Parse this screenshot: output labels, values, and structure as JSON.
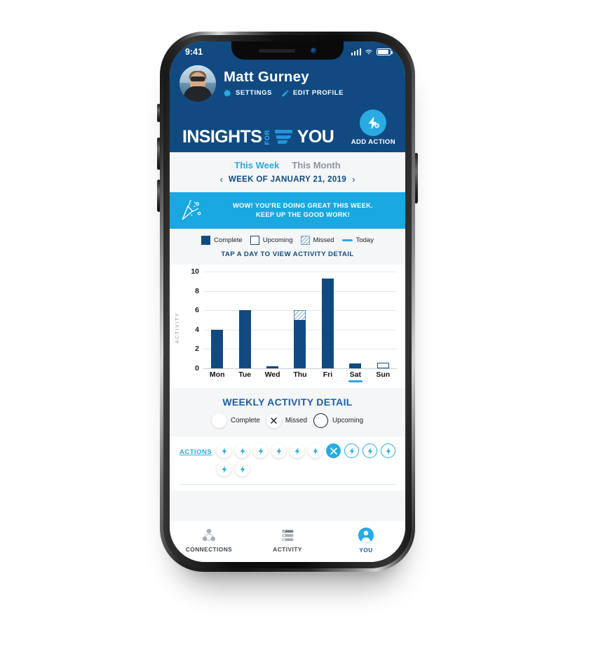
{
  "status_bar": {
    "time": "9:41",
    "signal_icon": "cellular-bars-icon",
    "wifi_icon": "wifi-icon",
    "battery_icon": "battery-icon"
  },
  "header": {
    "user_name": "Matt Gurney",
    "avatar_alt": "avatar",
    "settings_label": "SETTINGS",
    "settings_icon": "gear-icon",
    "edit_profile_label": "EDIT PROFILE",
    "edit_profile_icon": "pencil-icon",
    "logo_word1": "INSIGHTS",
    "logo_for": "FOR",
    "logo_word2": "YOU",
    "add_action_label": "ADD ACTION",
    "add_action_icon": "bolt-plus-icon",
    "bg_color": "#104a81",
    "accent_color": "#29aae2"
  },
  "tabs": [
    {
      "label": "This Week",
      "active": true
    },
    {
      "label": "This Month",
      "active": false
    }
  ],
  "week_nav": {
    "prev_icon": "chevron-left-icon",
    "next_icon": "chevron-right-icon",
    "label": "WEEK OF JANUARY 21, 2019"
  },
  "banner": {
    "icon": "party-popper-icon",
    "line1": "WOW! YOU'RE DOING GREAT THIS WEEK.",
    "line2": "KEEP UP THE GOOD WORK!",
    "bg_color": "#19a8e0"
  },
  "legend": [
    {
      "label": "Complete",
      "type": "complete"
    },
    {
      "label": "Upcoming",
      "type": "upcoming"
    },
    {
      "label": "Missed",
      "type": "missed"
    },
    {
      "label": "Today",
      "type": "today"
    }
  ],
  "tap_hint": "TAP A DAY TO VIEW ACTIVITY DETAIL",
  "chart_data": {
    "type": "bar",
    "title": "",
    "xlabel": "",
    "ylabel": "ACTIVITY",
    "categories": [
      "Mon",
      "Tue",
      "Wed",
      "Thu",
      "Fri",
      "Sat",
      "Sun"
    ],
    "ylim": [
      0,
      10
    ],
    "yticks": [
      0,
      2,
      4,
      6,
      8,
      10
    ],
    "grid": true,
    "legend_position": "above-plot",
    "today": "Sat",
    "series": [
      {
        "name": "Complete",
        "values": [
          4,
          6,
          0.2,
          5,
          9.3,
          0.5,
          0
        ]
      },
      {
        "name": "Missed",
        "values": [
          0,
          0,
          0,
          1,
          0,
          0,
          0
        ]
      },
      {
        "name": "Upcoming",
        "values": [
          0,
          0,
          0,
          0,
          0,
          0,
          0.6
        ]
      }
    ],
    "totals": [
      4,
      6,
      0.2,
      6,
      9.3,
      0.5,
      0.6
    ]
  },
  "weekly_detail": {
    "title": "WEEKLY ACTIVITY DETAIL",
    "legend": [
      {
        "label": "Complete",
        "type": "complete",
        "icon": "filled-circle-icon"
      },
      {
        "label": "Missed",
        "type": "missed",
        "icon": "x-icon"
      },
      {
        "label": "Upcoming",
        "type": "upcoming",
        "icon": "outline-circle-icon"
      }
    ]
  },
  "actions": {
    "label": "ACTIONS",
    "items": [
      {
        "state": "done",
        "icon": "bolt-icon"
      },
      {
        "state": "done",
        "icon": "bolt-icon"
      },
      {
        "state": "done",
        "icon": "bolt-icon"
      },
      {
        "state": "done",
        "icon": "bolt-icon"
      },
      {
        "state": "done",
        "icon": "bolt-icon"
      },
      {
        "state": "done",
        "icon": "bolt-icon"
      },
      {
        "state": "missed",
        "icon": "x-icon"
      },
      {
        "state": "upcoming",
        "icon": "bolt-icon"
      },
      {
        "state": "upcoming",
        "icon": "bolt-icon"
      },
      {
        "state": "upcoming",
        "icon": "bolt-icon"
      },
      {
        "state": "done",
        "icon": "bolt-icon"
      },
      {
        "state": "done",
        "icon": "bolt-icon"
      }
    ]
  },
  "bottom_nav": [
    {
      "label": "CONNECTIONS",
      "icon": "connections-icon",
      "active": false
    },
    {
      "label": "ACTIVITY",
      "icon": "activity-list-icon",
      "active": false
    },
    {
      "label": "YOU",
      "icon": "person-icon",
      "active": true
    }
  ]
}
